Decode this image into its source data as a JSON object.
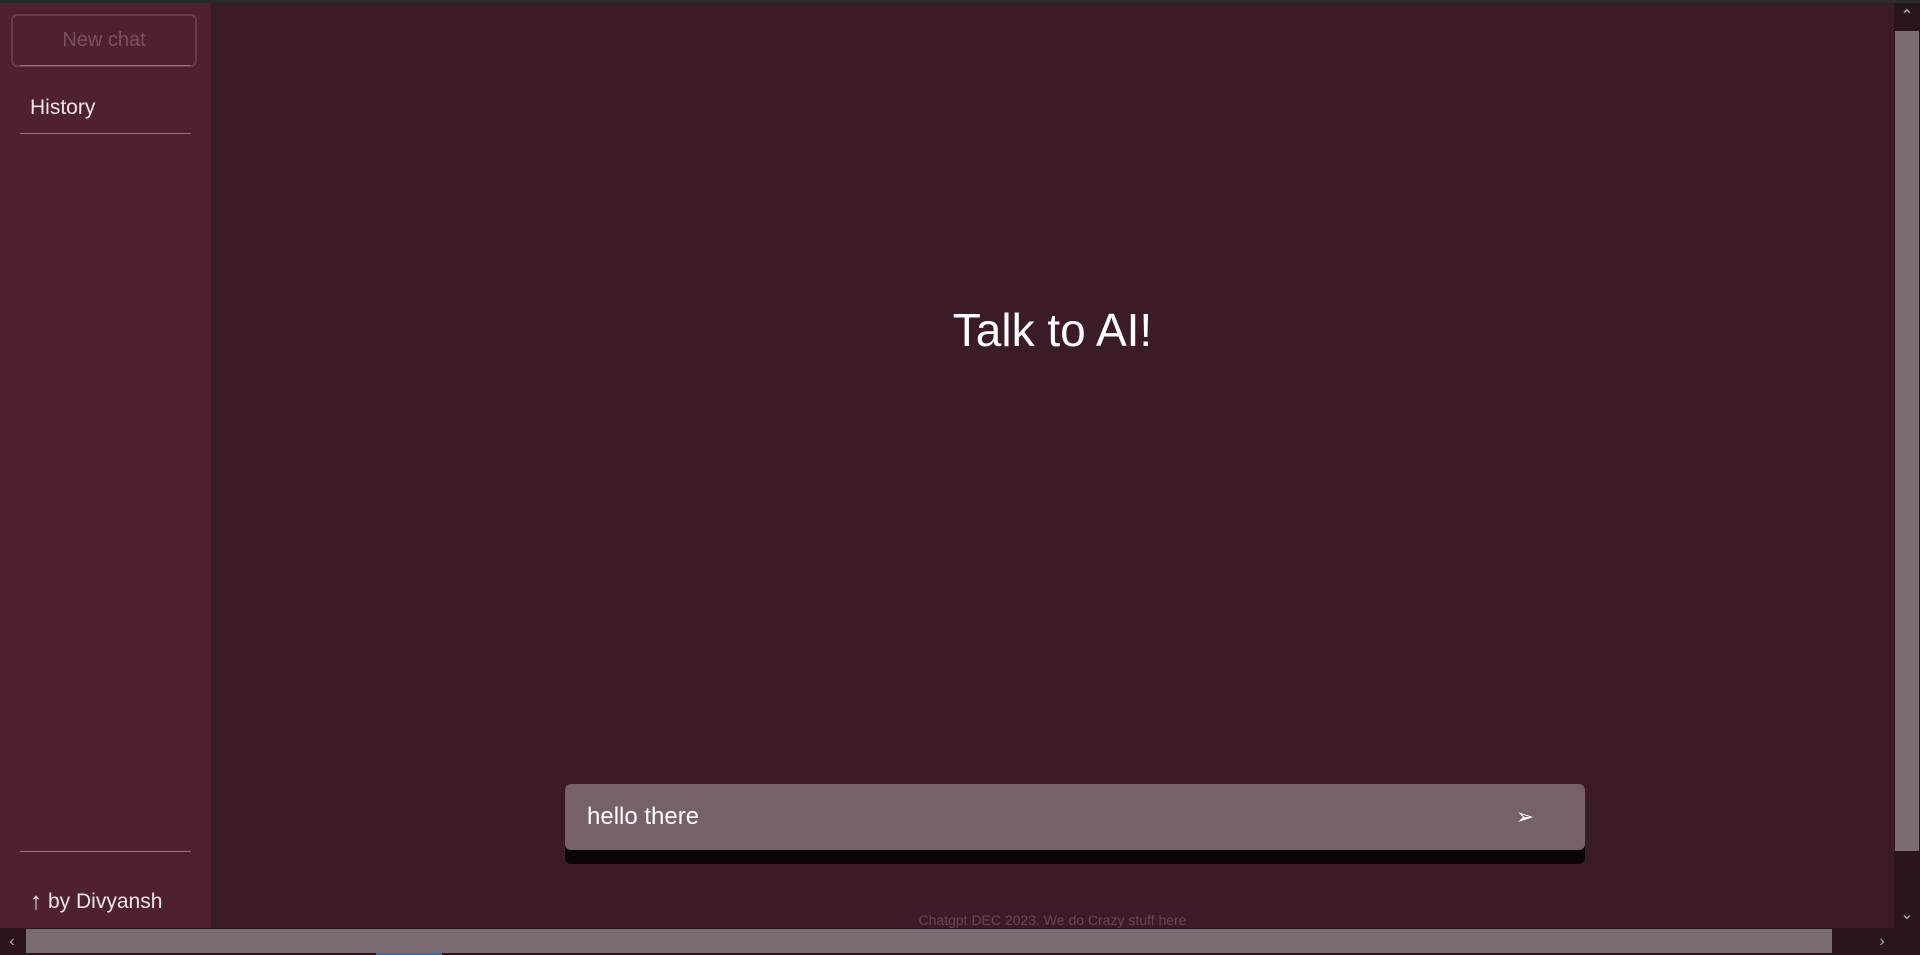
{
  "sidebar": {
    "new_chat_label": "New chat",
    "history_label": "History",
    "author_arrow": "↑",
    "author_label": "by Divyansh"
  },
  "main": {
    "headline": "Talk to AI!",
    "input": {
      "value": "hello there",
      "placeholder": ""
    },
    "send_icon": "➢",
    "footer_note": "Chatgpt DEC 2023. We do Crazy stuff here"
  },
  "scrollbars": {
    "up_arrow": "⌃",
    "down_arrow": "⌄",
    "left_arrow": "‹",
    "right_arrow": "›"
  },
  "colors": {
    "sidebar_bg": "#4e2030",
    "main_bg": "#3b1a2a",
    "input_bg": "#76606c",
    "text": "#ffffff"
  }
}
